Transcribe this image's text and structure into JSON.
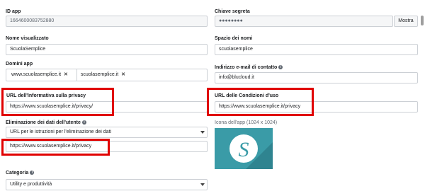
{
  "app_id": {
    "label": "ID app",
    "value": "1664600083752880"
  },
  "secret": {
    "label": "Chiave segreta",
    "value": "●●●●●●●●",
    "button": "Mostra"
  },
  "display_name": {
    "label": "Nome visualizzato",
    "value": "ScuolaSemplice"
  },
  "namespace": {
    "label": "Spazio dei nomi",
    "value": "scuolasemplice"
  },
  "domains": {
    "label": "Domini app",
    "tags": [
      "www.scuolasemplice.it",
      "scuolasemplice.it"
    ]
  },
  "contact_email": {
    "label": "Indirizzo e-mail di contatto",
    "value": "info@blucloud.it"
  },
  "privacy_url": {
    "label": "URL dell'Informativa sulla privacy",
    "value": "https://www.scuolasemplice.it/privacy/"
  },
  "terms_url": {
    "label": "URL delle Condizioni d'uso",
    "value": "https://www.scuolasemplice.it/privacy"
  },
  "data_deletion": {
    "label": "Eliminazione dei dati dell'utente",
    "select_value": "URL per le istruzioni per l'eliminazione dei dati",
    "url_value": "https://www.scuolasemplice.it/privacy"
  },
  "app_icon": {
    "label": "Icona dell'app (1024 x 1024)",
    "letter": "S"
  },
  "category": {
    "label": "Categoria",
    "value": "Utility e produttività"
  },
  "colors": {
    "highlight": "#e00000",
    "icon_bg": "#3a9ba7"
  }
}
